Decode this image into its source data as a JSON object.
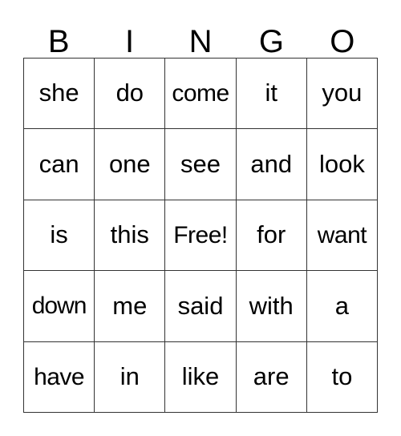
{
  "card": {
    "headers": [
      "B",
      "I",
      "N",
      "G",
      "O"
    ],
    "free_space_label": "Free!",
    "colors": {
      "background": "#ffffff",
      "text": "#000000",
      "border": "#333333"
    },
    "rows": [
      [
        "she",
        "do",
        "come",
        "it",
        "you"
      ],
      [
        "can",
        "one",
        "see",
        "and",
        "look"
      ],
      [
        "is",
        "this",
        "Free!",
        "for",
        "want"
      ],
      [
        "down",
        "me",
        "said",
        "with",
        "a"
      ],
      [
        "have",
        "in",
        "like",
        "are",
        "to"
      ]
    ]
  }
}
